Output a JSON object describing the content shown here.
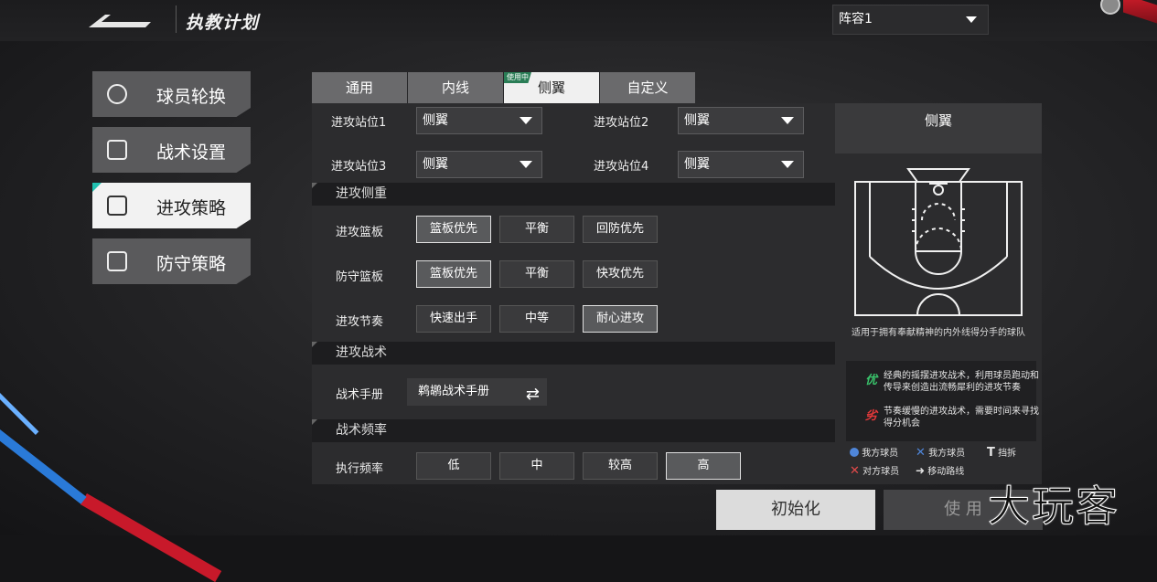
{
  "header": {
    "title": "执教计划",
    "lineup": "阵容1"
  },
  "sidebar": {
    "items": [
      {
        "label": "球员轮换",
        "icon": "player-rotation-icon"
      },
      {
        "label": "战术设置",
        "icon": "tactics-board-icon"
      },
      {
        "label": "进攻策略",
        "icon": "offense-basketball-icon",
        "active": true
      },
      {
        "label": "防守策略",
        "icon": "defense-shield-icon"
      }
    ]
  },
  "tabs": [
    {
      "label": "通用"
    },
    {
      "label": "内线"
    },
    {
      "label": "侧翼",
      "active": true,
      "badge": "使用中"
    },
    {
      "label": "自定义"
    }
  ],
  "positions": [
    {
      "label": "进攻站位1",
      "value": "侧翼"
    },
    {
      "label": "进攻站位2",
      "value": "侧翼"
    },
    {
      "label": "进攻站位3",
      "value": "侧翼"
    },
    {
      "label": "进攻站位4",
      "value": "侧翼"
    }
  ],
  "sections": {
    "emphasis": "进攻侧重",
    "tactics": "进攻战术",
    "frequency": "战术频率"
  },
  "rows": [
    {
      "label": "进攻篮板",
      "options": [
        "篮板优先",
        "平衡",
        "回防优先"
      ],
      "selected": 0
    },
    {
      "label": "防守篮板",
      "options": [
        "篮板优先",
        "平衡",
        "快攻优先"
      ],
      "selected": 0
    },
    {
      "label": "进攻节奏",
      "options": [
        "快速出手",
        "中等",
        "耐心进攻"
      ],
      "selected": 2
    }
  ],
  "manual": {
    "label": "战术手册",
    "value": "鹈鹕战术手册",
    "icon": "swap-icon"
  },
  "frequency": {
    "label": "执行频率",
    "options": [
      "低",
      "中",
      "较高",
      "高"
    ],
    "selected": 3
  },
  "preview": {
    "title": "侧翼",
    "desc": "适用于拥有奉献精神的内外线得分手的球队",
    "pro_tag": "优",
    "pro": "经典的摇摆进攻战术，利用球员跑动和传导来创造出流畅犀利的进攻节奏",
    "con_tag": "劣",
    "con": "节奏缓慢的进攻战术，需要时间来寻找得分机会",
    "legend": {
      "my_player": "我方球员",
      "my_player_x": "我方球员",
      "screen": "挡拆",
      "opponent": "对方球员",
      "move": "移动路线"
    }
  },
  "buttons": {
    "reset": "初始化",
    "use": "使 用"
  },
  "watermark": "大玩客",
  "colors": {
    "accent": "#21c0b0",
    "inuse_badge": "#2a7d56",
    "pro_green": "#39c36b",
    "con_red": "#e5393a",
    "legend_blue": "#4f86d9",
    "legend_red": "#e34a4a"
  }
}
